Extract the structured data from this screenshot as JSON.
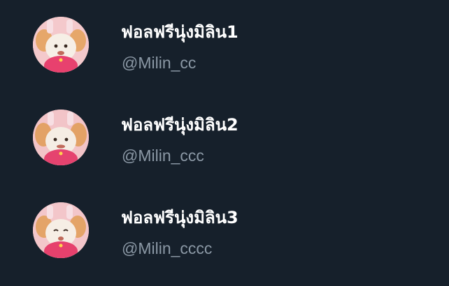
{
  "accounts": [
    {
      "name": "ฟอลฟรีนุ่งมิลิน1",
      "handle": "@Milin_cc",
      "avatar_icon": "cartoon-character-avatar"
    },
    {
      "name": "ฟอลฟรีนุ่งมิลิน2",
      "handle": "@Milin_ccc",
      "avatar_icon": "cartoon-character-avatar"
    },
    {
      "name": "ฟอลฟรีนุ่งมิลิน3",
      "handle": "@Milin_cccc",
      "avatar_icon": "cartoon-character-avatar"
    }
  ],
  "colors": {
    "background": "#16202b",
    "name_text": "#ffffff",
    "handle_text": "#8b98a5"
  }
}
